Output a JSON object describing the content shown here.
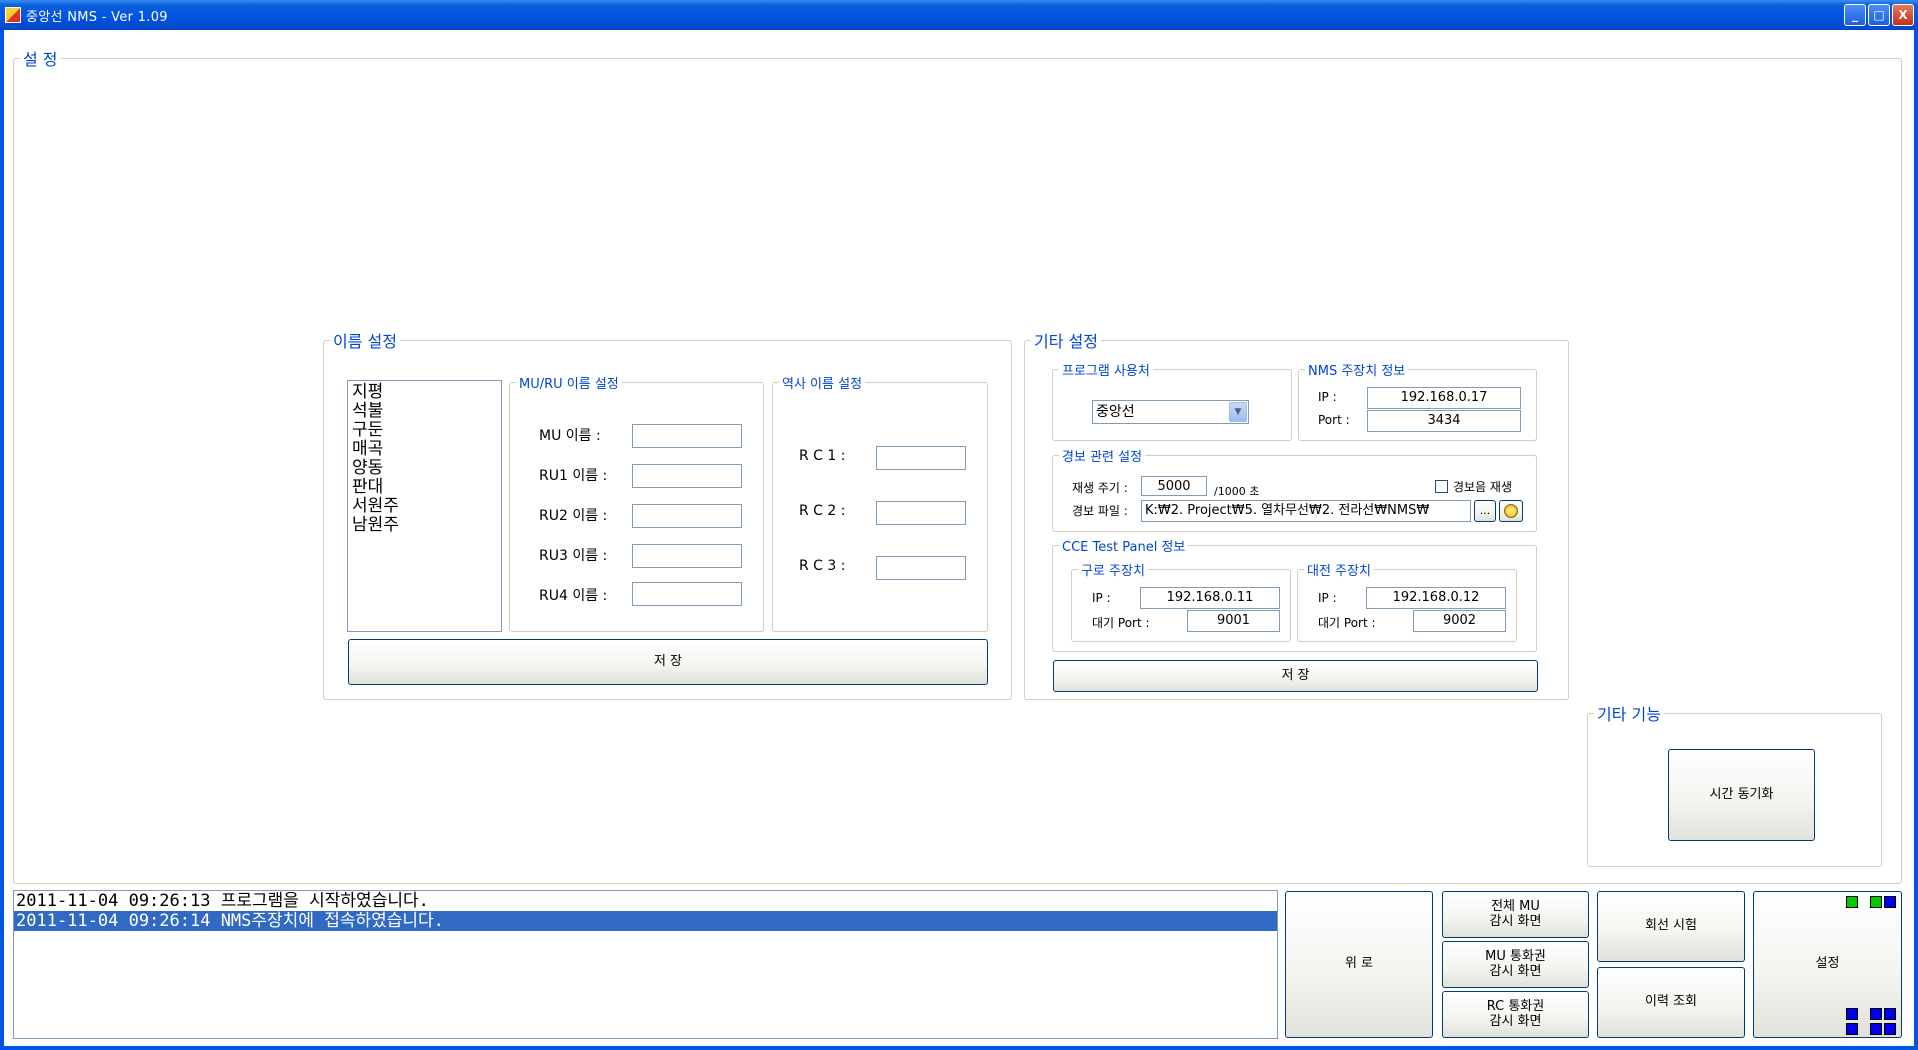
{
  "window": {
    "title": "중앙선 NMS  - Ver 1.09",
    "buttons": {
      "minimize": "_",
      "maximize": "□",
      "close": "X"
    }
  },
  "settings_group": {
    "title": "설 정"
  },
  "name_settings": {
    "title": "이름 설정",
    "stations": [
      "지평",
      "석불",
      "구둔",
      "매곡",
      "양동",
      "판대",
      "서원주",
      "남원주"
    ],
    "mu_ru": {
      "title": "MU/RU 이름 설정",
      "labels": [
        "MU 이름 :",
        "RU1 이름 :",
        "RU2 이름 :",
        "RU3 이름 :",
        "RU4 이름 :"
      ],
      "values": [
        "",
        "",
        "",
        "",
        ""
      ]
    },
    "station_names": {
      "title": "역사 이름 설정",
      "labels": [
        "R C 1 :",
        "R C 2 :",
        "R C 3 :"
      ],
      "values": [
        "",
        "",
        ""
      ]
    },
    "save_label": "저 장"
  },
  "other_settings": {
    "title": "기타 설정",
    "program_user": {
      "title": "프로그램 사용처",
      "selected": "중앙선"
    },
    "nms_info": {
      "title": "NMS 주장치 정보",
      "ip_label": "IP :",
      "ip": "192.168.0.17",
      "port_label": "Port :",
      "port": "3434"
    },
    "alarm": {
      "title": "경보 관련 설정",
      "period_label": "재생 주기 :",
      "period_value": "5000",
      "period_unit": "/1000 초",
      "sound_check_label": "경보음 재생",
      "file_label": "경보 파일 :",
      "file_value": "K:₩2. Project₩5. 열차무선₩2. 전라선₩NMS₩",
      "browse_label": "..."
    },
    "cce": {
      "title": "CCE Test Panel 정보",
      "guro": {
        "title": "구로 주장치",
        "ip_label": "IP :",
        "ip": "192.168.0.11",
        "port_label": "대기 Port :",
        "port": "9001"
      },
      "daejeon": {
        "title": "대전 주장치",
        "ip_label": "IP :",
        "ip": "192.168.0.12",
        "port_label": "대기 Port :",
        "port": "9002"
      }
    },
    "save_label": "저 장"
  },
  "misc_functions": {
    "title": "기타 기능",
    "time_sync_label": "시간 동기화"
  },
  "log": {
    "lines": [
      "2011-11-04 09:26:13 프로그램을 시작하였습니다.",
      "2011-11-04 09:26:14 NMS주장치에 접속하였습니다."
    ],
    "selected_index": 1
  },
  "nav": {
    "top_label": "위 로",
    "all_mu_line1": "전체 MU",
    "all_mu_line2": "감시 화면",
    "mu_call_line1": "MU 통화권",
    "mu_call_line2": "감시 화면",
    "rc_call_line1": "RC 통화권",
    "rc_call_line2": "감시 화면",
    "line_test": "회선 시험",
    "history": "이력 조회",
    "settings": "설정"
  },
  "colors": {
    "accent": "#0046d5",
    "titlebar": "#0054e3",
    "selection": "#316ac5",
    "green_led": "#00cc00",
    "blue_led": "#0000ee"
  }
}
